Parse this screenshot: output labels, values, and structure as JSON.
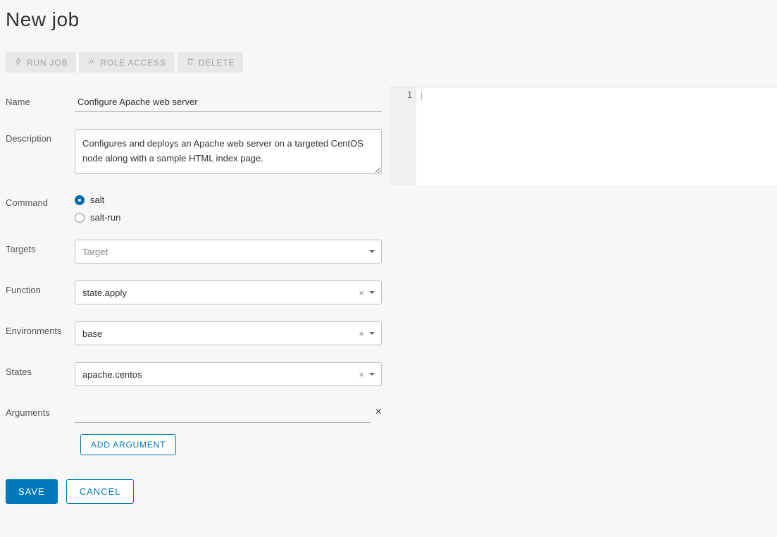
{
  "title": "New job",
  "toolbar": {
    "run_job": "RUN JOB",
    "role_access": "ROLE ACCESS",
    "delete": "DELETE"
  },
  "labels": {
    "name": "Name",
    "description": "Description",
    "command": "Command",
    "targets": "Targets",
    "function": "Function",
    "environments": "Environments",
    "states": "States",
    "arguments": "Arguments"
  },
  "fields": {
    "name_value": "Configure Apache web server",
    "description_value": "Configures and deploys an Apache web server on a targeted CentOS node along with a sample HTML index page.",
    "targets_placeholder": "Target",
    "function_value": "state.apply",
    "environments_value": "base",
    "states_value": "apache.centos",
    "argument_value": ""
  },
  "command_options": {
    "salt": "salt",
    "salt_run": "salt-run",
    "selected": "salt"
  },
  "buttons": {
    "add_argument": "ADD ARGUMENT",
    "save": "SAVE",
    "cancel": "CANCEL"
  },
  "editor": {
    "line_number": "1",
    "content": ""
  }
}
